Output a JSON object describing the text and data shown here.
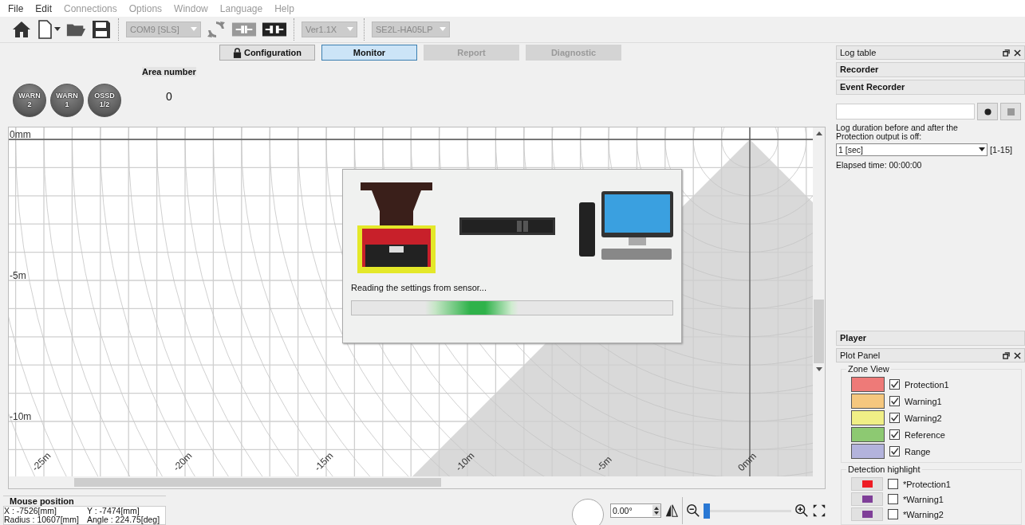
{
  "menu": [
    {
      "label": "File",
      "disabled": false
    },
    {
      "label": "Edit",
      "disabled": false
    },
    {
      "label": "Connections",
      "disabled": true
    },
    {
      "label": "Options",
      "disabled": true
    },
    {
      "label": "Window",
      "disabled": true
    },
    {
      "label": "Language",
      "disabled": true
    },
    {
      "label": "Help",
      "disabled": true
    }
  ],
  "toolbar": {
    "port": "COM9 [SLS]",
    "version": "Ver1.1X",
    "model": "SE2L-HA05LP"
  },
  "tabs": [
    {
      "label": "Configuration",
      "selected": false,
      "disabled": false,
      "locked": true
    },
    {
      "label": "Monitor",
      "selected": true,
      "disabled": false,
      "locked": false
    },
    {
      "label": "Report",
      "selected": false,
      "disabled": true,
      "locked": false
    },
    {
      "label": "Diagnostic",
      "selected": false,
      "disabled": true,
      "locked": false
    }
  ],
  "indicators": [
    {
      "line1": "WARN",
      "line2": "2",
      "lit": false
    },
    {
      "line1": "WARN",
      "line2": "1",
      "lit": false
    },
    {
      "line1": "OSSD",
      "line2": "1/2",
      "lit": false
    }
  ],
  "area_number": {
    "label": "Area number",
    "value": "0"
  },
  "plot": {
    "y_labels": [
      "0mm",
      "-5m",
      "-10m"
    ],
    "x_labels": [
      "-25m",
      "-20m",
      "-15m",
      "-10m",
      "-5m",
      "0mm"
    ]
  },
  "dialog": {
    "message": "Reading the settings from sensor...",
    "progress": {
      "level": 0.52
    }
  },
  "mouse_position": {
    "title": "Mouse position",
    "x": "X : -7526[mm]",
    "y": "Y : -7474[mm]",
    "radius": "Radius : 10607[mm]",
    "angle": "Angle : 224.75[deg]"
  },
  "rotation": {
    "value": "0.00°"
  },
  "zoom": {
    "level": 0.0
  },
  "log_table": {
    "title": "Log table",
    "recorder": "Recorder",
    "event_recorder": "Event Recorder",
    "duration_label": "Log duration before and after the Protection output is off:",
    "duration": "1 [sec]",
    "range": "[1-15]",
    "elapsed": "Elapsed time: 00:00:00",
    "player": "Player"
  },
  "plot_panel": {
    "title": "Plot Panel",
    "zone_view": {
      "title": "Zone View",
      "items": [
        {
          "label": "Protection1",
          "color": "#ee7a78",
          "checked": true
        },
        {
          "label": "Warning1",
          "color": "#f5c77e",
          "checked": true
        },
        {
          "label": "Warning2",
          "color": "#f0ef86",
          "checked": true
        },
        {
          "label": "Reference",
          "color": "#8dc972",
          "checked": true
        },
        {
          "label": "Range",
          "color": "#b3b3dc",
          "checked": true
        }
      ]
    },
    "detection_highlight": {
      "title": "Detection highlight",
      "items": [
        {
          "label": "*Protection1",
          "color": "#ee1c24",
          "checked": false
        },
        {
          "label": "*Warning1",
          "color": "#7f3f98",
          "checked": false
        },
        {
          "label": "*Warning2",
          "color": "#7f3f98",
          "checked": false
        }
      ]
    }
  }
}
